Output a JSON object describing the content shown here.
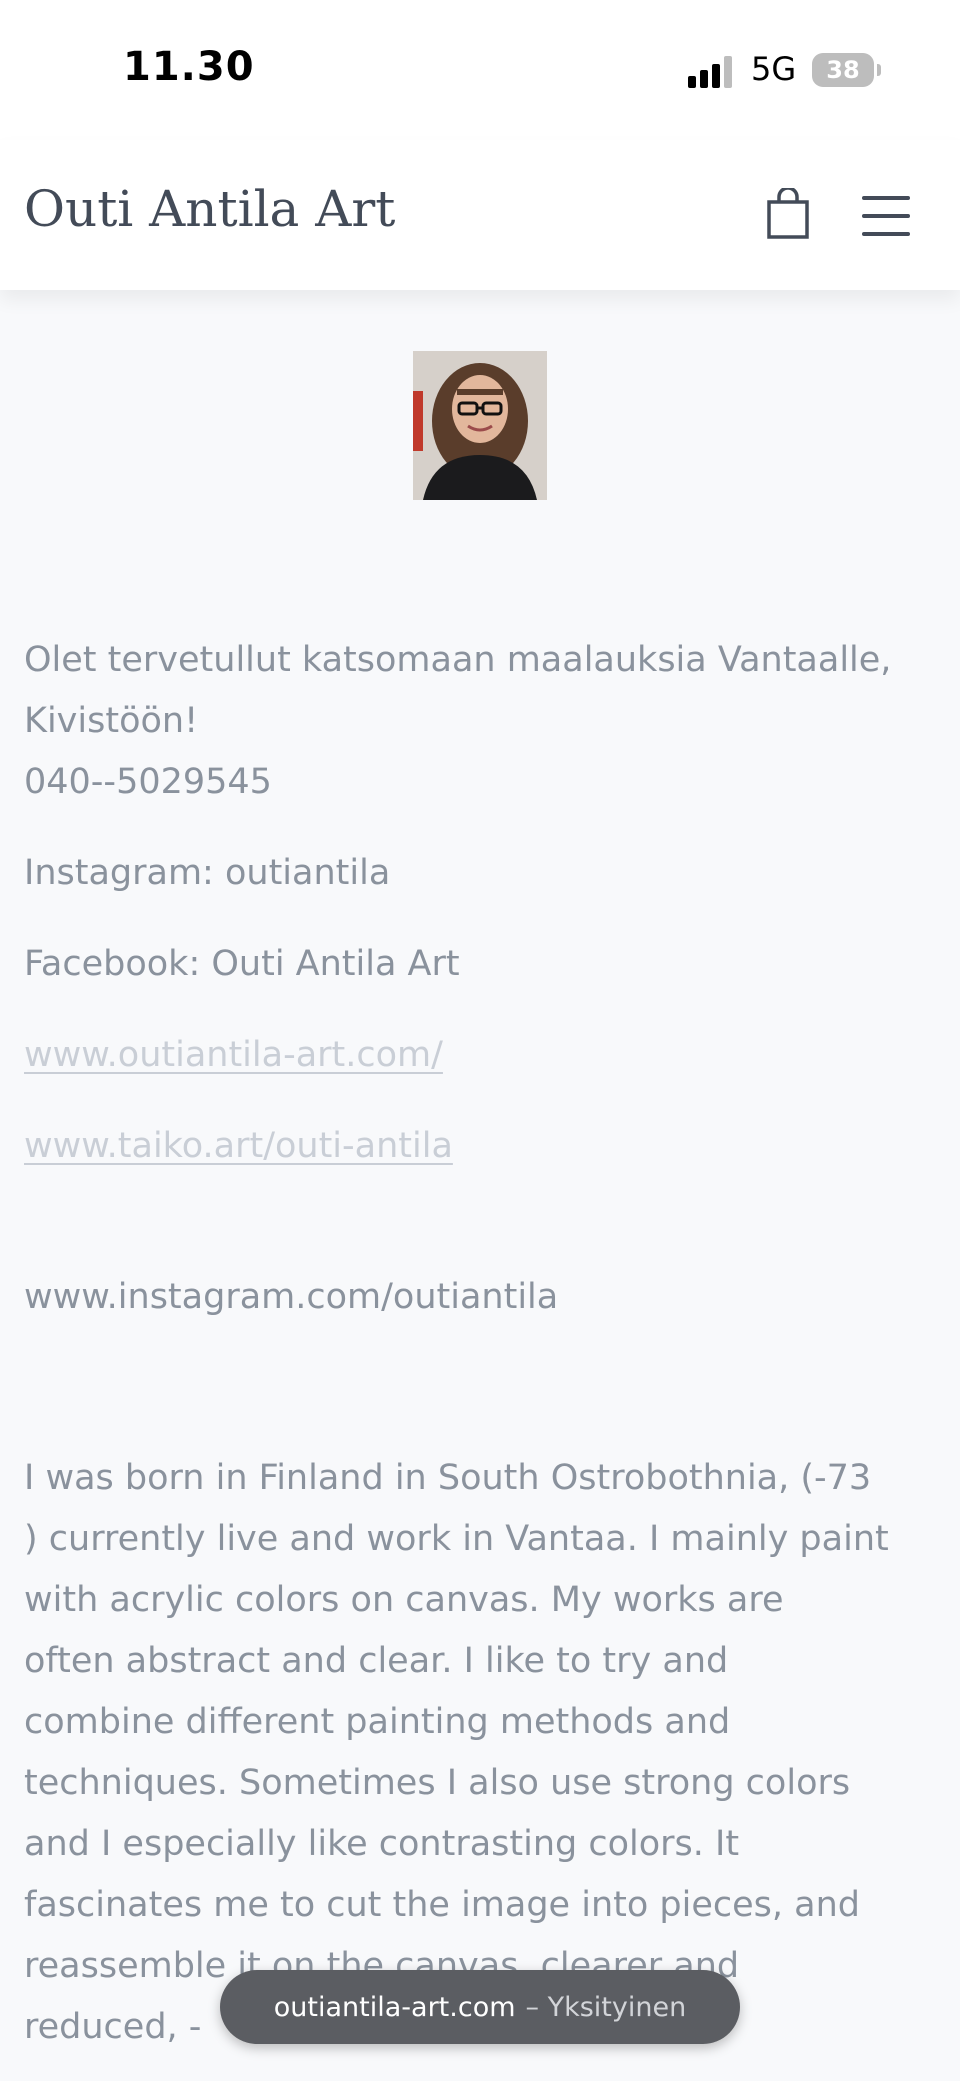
{
  "status_bar": {
    "time": "11.30",
    "network": "5G",
    "battery": "38"
  },
  "header": {
    "brand": "Outi Antila Art",
    "cart_icon": "shopping-bag-icon",
    "menu_icon": "hamburger-menu-icon"
  },
  "content": {
    "welcome_line1": "Olet tervetullut katsomaan maalauksia Vantaalle,",
    "welcome_line2": "Kivistöön!",
    "phone": "040--5029545",
    "instagram": "Instagram: outiantila",
    "facebook": "Facebook: Outi Antila Art",
    "link_site": "www.outiantila-art.com/",
    "link_taiko": "www.taiko.art/outi-antila",
    "instagram_url": "www.instagram.com/outiantila",
    "bio": [
      "I was born in Finland in South Ostrobothnia, (-73",
      ") currently live and work in Vantaa. I mainly paint",
      "with acrylic colors on canvas. My works are",
      "often abstract and clear. I like to try and",
      "combine different painting methods and",
      "techniques. Sometimes I also use strong colors",
      "and I especially like contrasting colors. It",
      "fascinates me to cut the image into pieces, and",
      "reassemble it on the canvas, clearer and",
      "reduced, -"
    ]
  },
  "browser": {
    "domain": "outiantila-art.com",
    "mode": "– Yksityinen"
  }
}
